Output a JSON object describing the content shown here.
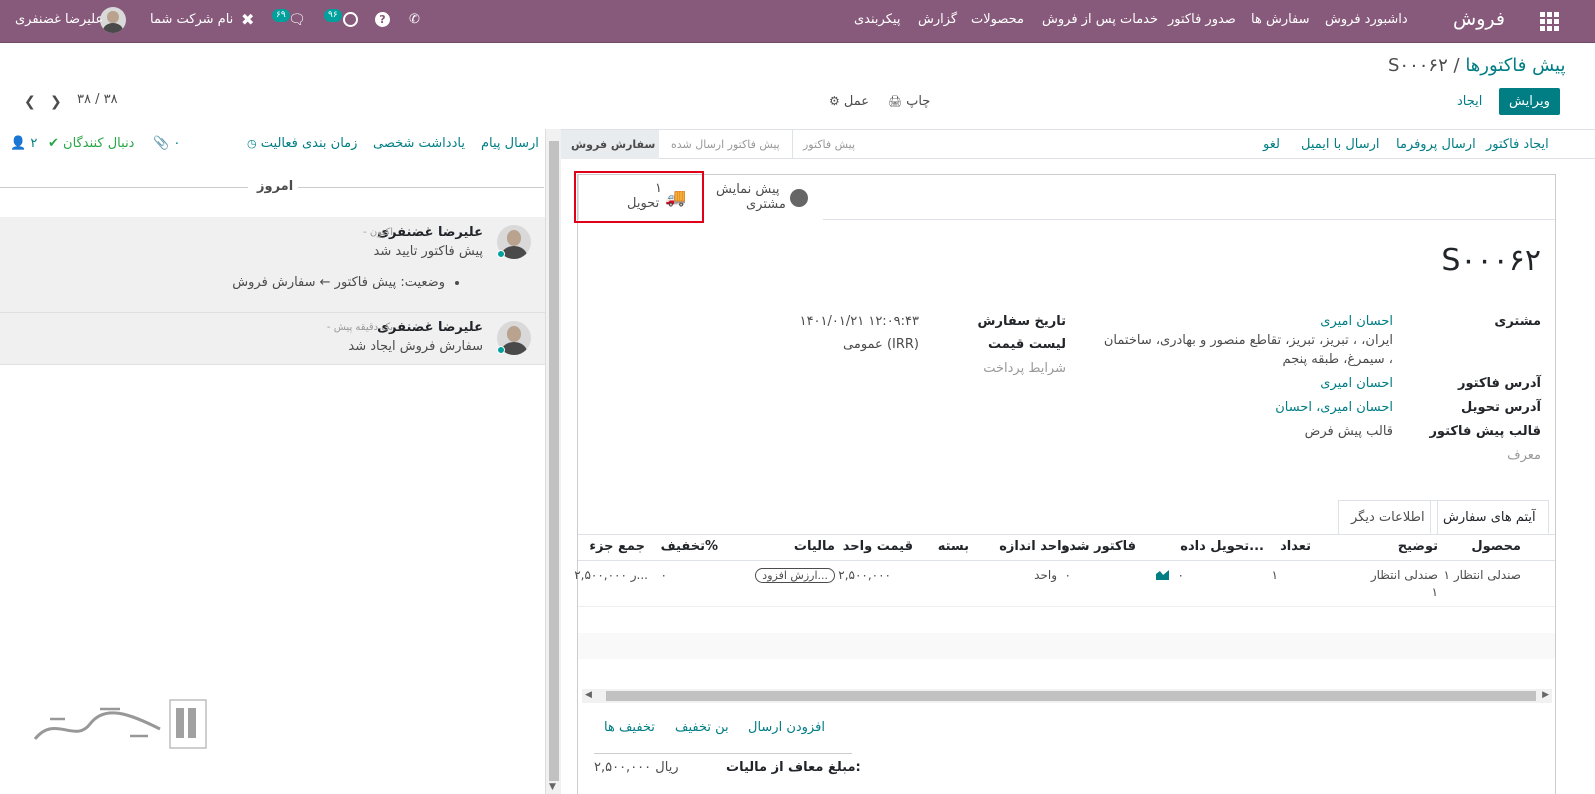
{
  "navbar": {
    "app_name": "فروش",
    "menu": [
      "داشبورد فروش",
      "سفارش ها",
      "صدور فاکتور",
      "خدمات پس از فروش",
      "محصولات",
      "گزارش",
      "پیکربندی"
    ],
    "company": "نام شرکت شما",
    "user": "علیرضا غضنفری",
    "activity_count": "۹۶",
    "message_count": "۶۹"
  },
  "breadcrumb": {
    "parent": "پیش فاکتورها",
    "separator": "/",
    "current": "S۰۰۰۶۲"
  },
  "controls": {
    "edit": "ویرایش",
    "create": "ایجاد",
    "print": "چاپ",
    "action": "عمل",
    "pager": "۳۸ / ۳۸"
  },
  "statusbar": {
    "actions": [
      "ایجاد فاکتور",
      "ارسال پروفرما",
      "ارسال با ایمیل",
      "لغو"
    ],
    "stages": [
      "سفارش فروش",
      "پیش فاکتور ارسال شده",
      "پیش فاکتور"
    ],
    "active_stage": "سفارش فروش"
  },
  "smart_buttons": {
    "preview_line1": "پیش نمایش",
    "preview_line2": "مشتری",
    "delivery_count": "۱",
    "delivery_label": "تحویل"
  },
  "order": {
    "name": "S۰۰۰۶۲",
    "customer_label": "مشتری",
    "customer_name": "احسان امیری",
    "customer_addr1": "ایران، ، تبریز، تبریز، تقاطع منصور و بهادری، ساختمان",
    "customer_addr2": "سیمرغ، طبقه پنجم ،",
    "invoice_addr_label": "آدرس فاکتور",
    "invoice_addr": "احسان امیری",
    "delivery_addr_label": "آدرس تحویل",
    "delivery_addr": "احسان امیری، احسان",
    "template_label": "قالب پیش فاکتور",
    "template": "قالب پیش فرض",
    "referrer_label": "معرف",
    "date_label": "تاریخ سفارش",
    "date": "۱۴۰۱/۰۱/۲۱ ۱۲:۰۹:۴۳",
    "pricelist_label": "لیست قیمت",
    "pricelist": "عمومی (IRR)",
    "payment_terms_label": "شرایط پرداخت"
  },
  "tabs": [
    "آیتم های سفارش",
    "اطلاعات دیگر"
  ],
  "lines": {
    "headers": [
      "محصول",
      "توضیح",
      "تعداد",
      "تحویل داده...",
      "فاکتور شده",
      "واحد اندازه ...",
      "بسته",
      "قیمت واحد",
      "مالیات",
      "تخفیف%",
      "جمع جزء"
    ],
    "row": {
      "product": "صندلی انتظار ۱",
      "desc1": "صندلی انتظار",
      "desc2": "۱",
      "qty": "۱",
      "delivered": "۰",
      "invoiced": "",
      "uom_qty": "۰",
      "uom": "واحد",
      "unit_price": "۲,۵۰۰,۰۰۰",
      "tax": "ارزش افزود...",
      "discount": "۰",
      "subtotal": "۲,۵۰۰,۰۰۰ ر..."
    }
  },
  "footer_actions": [
    "افزودن ارسال",
    "بن تخفیف",
    "تخفیف ها"
  ],
  "totals": {
    "untaxed_label": "مبلغ معاف از مالیات:",
    "untaxed": "۲,۵۰۰,۰۰۰ ریال"
  },
  "chatter": {
    "send_message": "ارسال پیام",
    "log_note": "یادداشت شخصی",
    "schedule": "زمان بندی فعالیت",
    "attachments": "۰",
    "follow": "دنبال کنندگان",
    "followers_count": "۲",
    "today": "امروز",
    "messages": [
      {
        "author": "علیرضا غضنفری",
        "time": "- اکنون",
        "body": "پیش فاکتور تایید شد",
        "tracking": "وضعیت: پیش فاکتور ← سفارش فروش"
      },
      {
        "author": "علیرضا غضنفری",
        "time": "- یک دقیقه پیش",
        "body": "سفارش فروش ایجاد شد"
      }
    ]
  },
  "colors": {
    "navbar": "#875a7b",
    "primary": "#017e84",
    "highlight_box": "#e0001a"
  }
}
